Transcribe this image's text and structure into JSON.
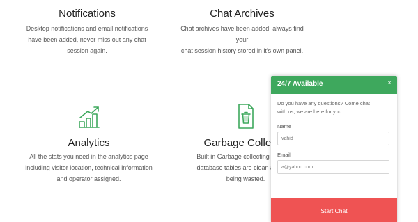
{
  "features": {
    "notifications": {
      "title": "Notifications",
      "desc_lines": [
        "Desktop notifications and email notifications",
        "have been added, never miss out any chat",
        "session again."
      ]
    },
    "archives": {
      "title": "Chat Archives",
      "desc_lines": [
        "Chat archives have been added, always find your",
        "chat session history stored in it's own panel."
      ]
    },
    "analytics": {
      "icon": "analytics-chart-icon",
      "title": "Analytics",
      "desc_lines": [
        "All the stats you need in the analytics page",
        "including visitor location, technical information",
        "and operator assigned."
      ]
    },
    "garbage": {
      "icon": "trash-file-icon",
      "title": "Garbage Collectio",
      "desc_lines": [
        "Built in Garbage collecting makes s",
        "database tables are clean and no c",
        "being wasted."
      ]
    }
  },
  "chat": {
    "title": "24/7 Available",
    "close": "×",
    "intro_lines": [
      "Do you have any questions? Come chat",
      "with us, we are here for you."
    ],
    "name_label": "Name",
    "name_value": "vahid",
    "email_label": "Email",
    "email_value": "a@yahoo.com",
    "start_label": "Start Chat",
    "header_color": "#3ea85d",
    "button_color": "#ef5353"
  },
  "colors": {
    "icon_green": "#3ea85d"
  }
}
